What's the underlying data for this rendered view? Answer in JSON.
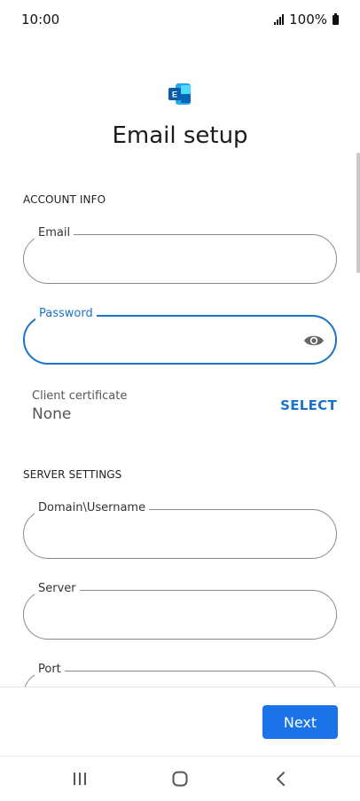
{
  "status_bar": {
    "time": "10:00",
    "battery": "100%"
  },
  "header": {
    "title": "Email setup",
    "logo_icon": "exchange-logo-icon",
    "brand_color": "#1a73c9"
  },
  "account_info": {
    "section_label": "ACCOUNT INFO",
    "email": {
      "label": "Email",
      "value": ""
    },
    "password": {
      "label": "Password",
      "value": ""
    },
    "client_certificate": {
      "label": "Client certificate",
      "value": "None",
      "action": "SELECT"
    }
  },
  "server_settings": {
    "section_label": "SERVER SETTINGS",
    "domain_username": {
      "label": "Domain\\Username",
      "value": ""
    },
    "server": {
      "label": "Server",
      "value": ""
    },
    "port": {
      "label": "Port",
      "value": ""
    }
  },
  "footer": {
    "next_label": "Next"
  },
  "nav": {
    "icons": [
      "recent-apps-icon",
      "home-icon",
      "back-icon"
    ]
  }
}
